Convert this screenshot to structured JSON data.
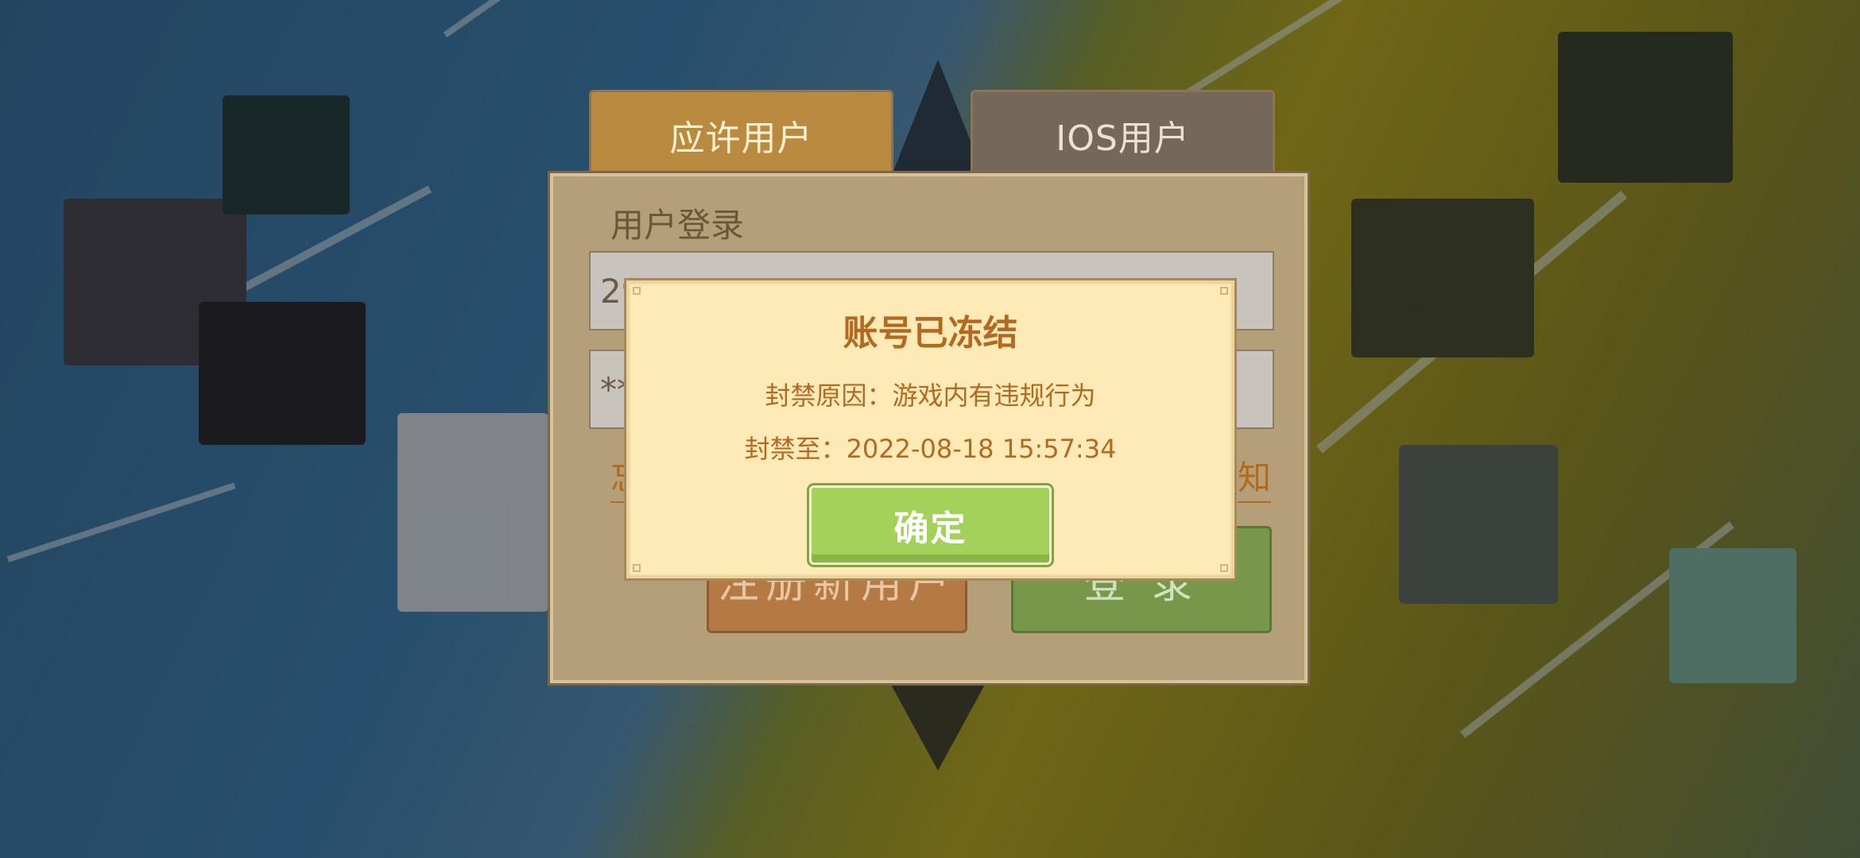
{
  "tabs": {
    "android_label": "应许用户",
    "ios_label": "IOS用户"
  },
  "login": {
    "title": "用户登录",
    "account_value": "29",
    "password_value": "**",
    "forgot_link": "忘",
    "notice_link": "知",
    "register_button": "注册新用户",
    "login_button": "登 录"
  },
  "dialog": {
    "title": "账号已冻结",
    "reason": "封禁原因：游戏内有违规行为",
    "until": "封禁至：2022-08-18 15:57:34",
    "confirm_button": "确定"
  }
}
